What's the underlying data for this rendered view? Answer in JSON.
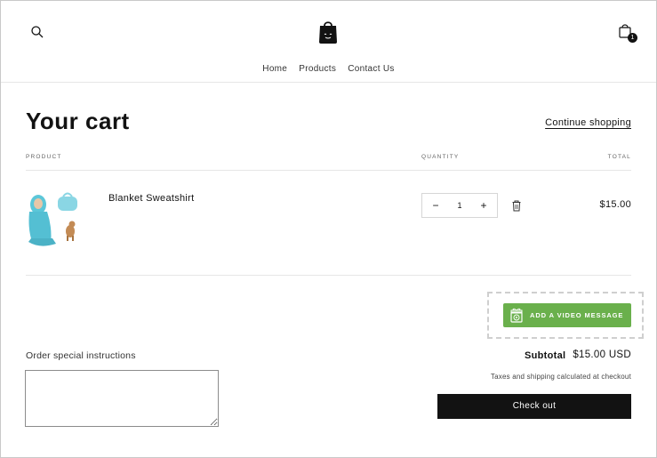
{
  "header": {
    "icons": {
      "search": "search-icon",
      "logo": "shopping-bag-logo-icon",
      "cart": "cart-icon"
    },
    "cart_count": "1",
    "nav": [
      "Home",
      "Products",
      "Contact Us"
    ]
  },
  "cart": {
    "title": "Your cart",
    "continue_link": "Continue shopping",
    "columns": {
      "product": "PRODUCT",
      "quantity": "QUANTITY",
      "total": "TOTAL"
    },
    "items": [
      {
        "name": "Blanket Sweatshirt",
        "quantity": "1",
        "price": "$15.00",
        "decrement": "−",
        "increment": "+"
      }
    ]
  },
  "video_message": {
    "label": "ADD A VIDEO MESSAGE",
    "color": "#6ab04c"
  },
  "instructions": {
    "label": "Order special instructions",
    "value": ""
  },
  "totals": {
    "subtotal_label": "Subtotal",
    "subtotal_value": "$15.00 USD",
    "tax_note": "Taxes and shipping calculated at checkout",
    "checkout_label": "Check out"
  }
}
